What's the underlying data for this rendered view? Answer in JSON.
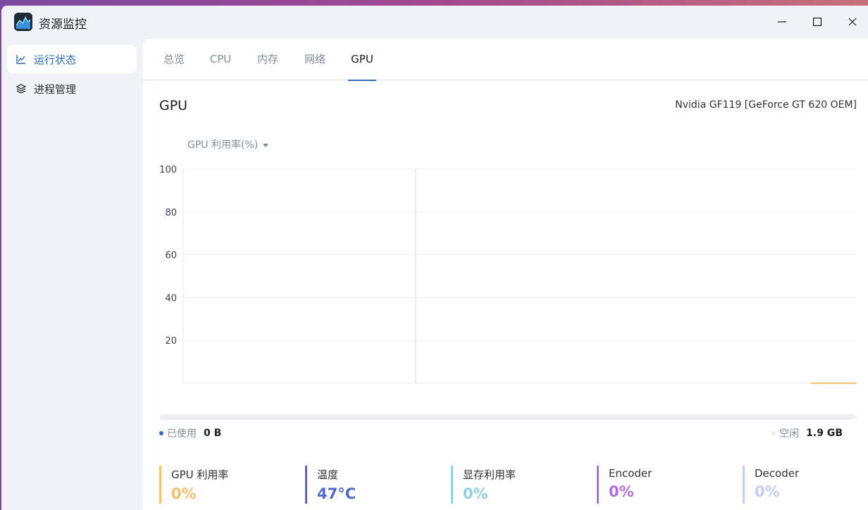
{
  "window": {
    "title": "资源监控",
    "controls": {
      "minimize": "minimize-icon",
      "maximize": "maximize-icon",
      "close": "close-icon"
    }
  },
  "sidebar": {
    "items": [
      {
        "label": "运行状态",
        "icon": "chart-line-icon",
        "active": true
      },
      {
        "label": "进程管理",
        "icon": "layers-icon",
        "active": false
      }
    ]
  },
  "tabs": [
    {
      "label": "总览",
      "active": false
    },
    {
      "label": "CPU",
      "active": false
    },
    {
      "label": "内存",
      "active": false
    },
    {
      "label": "网络",
      "active": false
    },
    {
      "label": "GPU",
      "active": true
    }
  ],
  "gpu": {
    "title": "GPU",
    "model": "Nvidia GF119 [GeForce GT 620 OEM]",
    "metric_selector": "GPU 利用率(%)",
    "memory": {
      "used_label": "已使用",
      "used_value": "0 B",
      "free_label": "空闲",
      "free_value": "1.9 GB",
      "used_fraction": 0
    },
    "stats": [
      {
        "label": "GPU 利用率",
        "value": "0%",
        "color": "#f5c06a"
      },
      {
        "label": "温度",
        "value": "47°C",
        "color": "#5468d4"
      },
      {
        "label": "显存利用率",
        "value": "0%",
        "color": "#8fd0e2"
      },
      {
        "label": "Encoder",
        "value": "0%",
        "color": "#b06ee6"
      },
      {
        "label": "Decoder",
        "value": "0%",
        "color": "#c4ccf5"
      }
    ]
  },
  "chart_data": {
    "type": "line",
    "title": "",
    "xlabel": "",
    "ylabel": "",
    "ylim": [
      0,
      100
    ],
    "yticks": [
      20,
      40,
      60,
      80,
      100
    ],
    "grid": true,
    "series": [
      {
        "values": [
          0,
          0,
          0
        ],
        "color": "#f5c06a"
      }
    ]
  }
}
